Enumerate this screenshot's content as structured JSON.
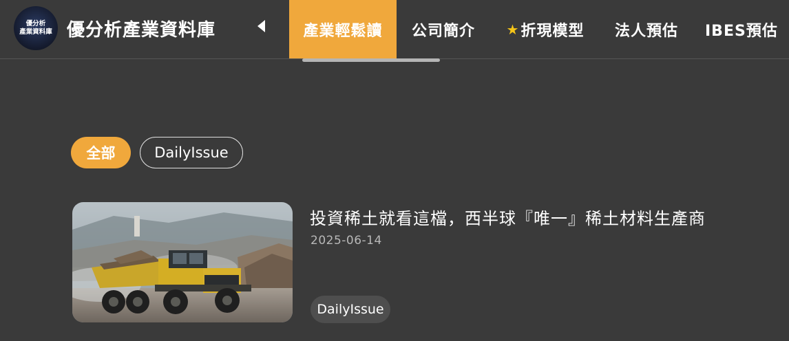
{
  "header": {
    "logo_lines": [
      "優分析",
      "產業資料庫"
    ],
    "site_title": "優分析產業資料庫",
    "scroll_left_icon": "caret-left-icon",
    "tabs": [
      {
        "label": "產業輕鬆讀",
        "active": true
      },
      {
        "label": "公司簡介",
        "active": false
      },
      {
        "label": "折現模型",
        "icon": "star-icon",
        "icon_glyph": "★",
        "active": false
      },
      {
        "label": "法人預估",
        "active": false
      },
      {
        "label": "IBES預估",
        "active": false
      }
    ]
  },
  "filters": [
    {
      "label": "全部",
      "active": true
    },
    {
      "label": "DailyIssue",
      "active": false
    }
  ],
  "articles": [
    {
      "title": "投資稀土就看這檔，西半球『唯一』稀土材料生產商",
      "date": "2025-06-14",
      "tag": "DailyIssue"
    }
  ],
  "colors": {
    "background": "#3a3a3a",
    "accent": "#f0a83c",
    "text": "#ffffff",
    "muted": "#b8b8b8",
    "tag_bg": "#4e4e4e"
  }
}
